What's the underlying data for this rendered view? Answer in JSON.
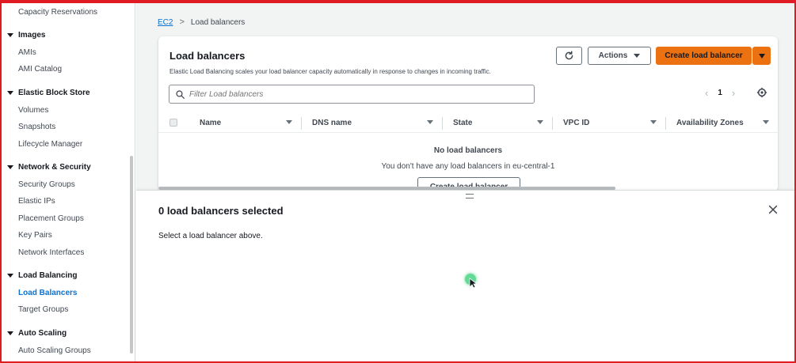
{
  "sidebar": {
    "items": [
      {
        "type": "item",
        "label": "Capacity Reservations"
      },
      {
        "type": "section",
        "label": "Images"
      },
      {
        "type": "item",
        "label": "AMIs"
      },
      {
        "type": "item",
        "label": "AMI Catalog"
      },
      {
        "type": "section",
        "label": "Elastic Block Store"
      },
      {
        "type": "item",
        "label": "Volumes"
      },
      {
        "type": "item",
        "label": "Snapshots"
      },
      {
        "type": "item",
        "label": "Lifecycle Manager"
      },
      {
        "type": "section",
        "label": "Network & Security"
      },
      {
        "type": "item",
        "label": "Security Groups"
      },
      {
        "type": "item",
        "label": "Elastic IPs"
      },
      {
        "type": "item",
        "label": "Placement Groups"
      },
      {
        "type": "item",
        "label": "Key Pairs"
      },
      {
        "type": "item",
        "label": "Network Interfaces"
      },
      {
        "type": "section",
        "label": "Load Balancing"
      },
      {
        "type": "item",
        "label": "Load Balancers",
        "active": true
      },
      {
        "type": "item",
        "label": "Target Groups"
      },
      {
        "type": "section",
        "label": "Auto Scaling"
      },
      {
        "type": "item",
        "label": "Auto Scaling Groups"
      }
    ]
  },
  "breadcrumb": {
    "root": "EC2",
    "separator": ">",
    "current": "Load balancers"
  },
  "panel": {
    "title": "Load balancers",
    "description": "Elastic Load Balancing scales your load balancer capacity automatically in response to changes in incoming traffic.",
    "actions_label": "Actions",
    "create_label": "Create load balancer",
    "filter_placeholder": "Filter Load balancers",
    "page_number": "1",
    "columns": [
      "Name",
      "DNS name",
      "State",
      "VPC ID",
      "Availability Zones"
    ],
    "empty_title": "No load balancers",
    "empty_description": "You don't have any load balancers in eu-central-1",
    "empty_button": "Create load balancer"
  },
  "split_panel": {
    "title": "0 load balancers selected",
    "description": "Select a load balancer above."
  },
  "colors": {
    "accent_link": "#0972d3",
    "primary_button": "#ec7211",
    "frame_border": "#e01b24",
    "cursor_highlight": "#2ecc71"
  },
  "icons": [
    "refresh-icon",
    "search-icon",
    "chevron-left-icon",
    "chevron-right-icon",
    "settings-icon",
    "sort-icon",
    "close-icon",
    "drag-handle-icon"
  ]
}
